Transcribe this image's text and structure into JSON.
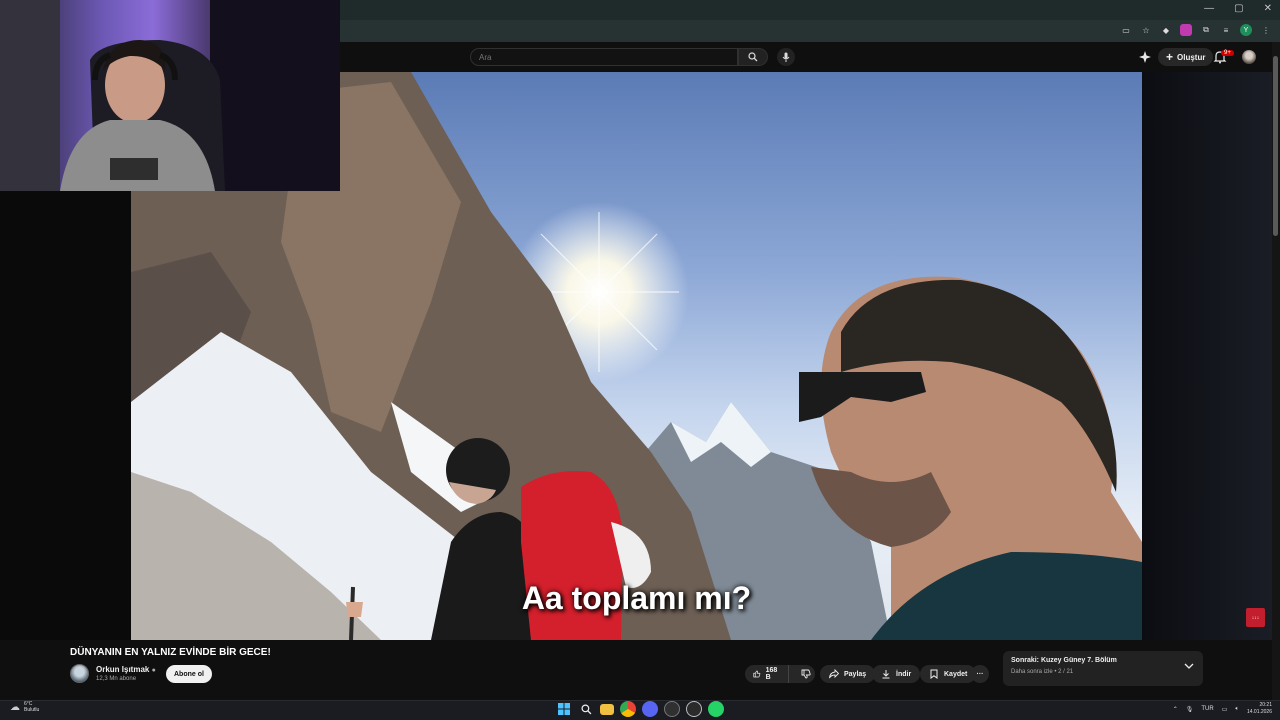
{
  "window_controls": [
    "—",
    "▢",
    "✕"
  ],
  "masthead": {
    "search_placeholder": "Ara",
    "create_label": "Oluştur",
    "notification_badge": "9+"
  },
  "video": {
    "subtitle": "Aa toplamı mı?",
    "corner_logo_text": "↓↓↓"
  },
  "info": {
    "title": "DÜNYANIN EN YALNIZ EVİNDE BİR GECE!",
    "channel_name": "Orkun Işıtmak",
    "subscribers": "12,3 Mn abone",
    "subscribe_label": "Abone ol",
    "likes": "168 B",
    "share_label": "Paylaş",
    "download_label": "İndir",
    "save_label": "Kaydet",
    "more_label": "···"
  },
  "next_card": {
    "title": "Sonraki: Kuzey Güney 7. Bölüm",
    "subtitle": "Daha sonra izle • 2 / 21"
  },
  "taskbar": {
    "weather_temp": "6°C",
    "weather_desc": "Bulutlu",
    "language": "TUR",
    "time": "20:21",
    "date": "14.01.2026"
  },
  "colors": {
    "accent_red": "#cc0000",
    "pack_red": "#d4202c",
    "youtube_bg": "#0f0f0f"
  }
}
